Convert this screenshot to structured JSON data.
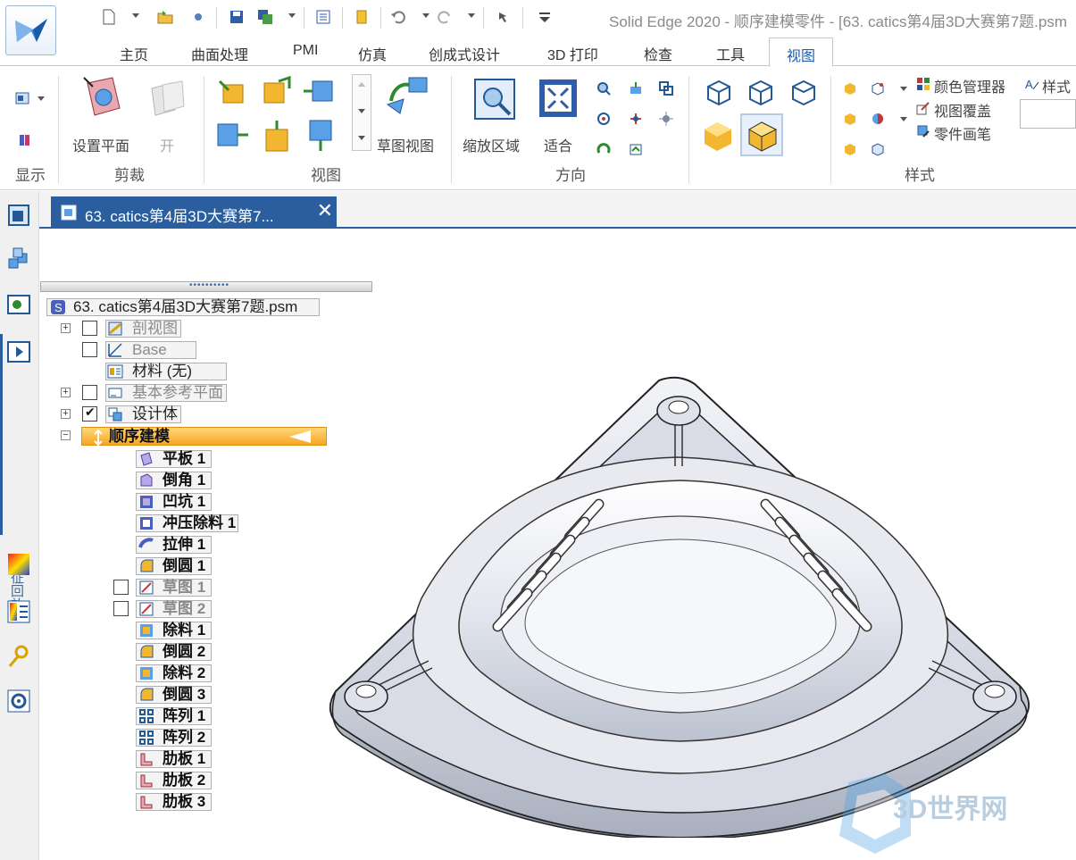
{
  "app": {
    "title": "Solid Edge 2020 - 顺序建模零件 - [63. catics第4届3D大赛第7题.psm"
  },
  "tabs": [
    {
      "label": "主页"
    },
    {
      "label": "曲面处理"
    },
    {
      "label": "PMI"
    },
    {
      "label": "仿真"
    },
    {
      "label": "创成式设计"
    },
    {
      "label": "3D 打印"
    },
    {
      "label": "检查"
    },
    {
      "label": "工具"
    },
    {
      "label": "视图",
      "active": true
    }
  ],
  "ribbon": {
    "groups": {
      "display": "显示",
      "clip": "剪裁",
      "views": "视图",
      "orient": "方向",
      "style": "样式"
    },
    "buttons": {
      "set_plane": "设置平面",
      "open": "开",
      "sketch_view": "草图视图",
      "zoom_area": "缩放区域",
      "fit": "适合",
      "color_manager": "颜色管理器",
      "style": "样式",
      "view_override": "视图覆盖",
      "part_painter": "零件画笔"
    }
  },
  "document_tab": {
    "title": "63. catics第4届3D大赛第7...",
    "close": "✕"
  },
  "left_toolbar": {
    "replay_label": "特征回放"
  },
  "tree": {
    "root": "63. catics第4届3D大赛第7题.psm",
    "nodes": [
      {
        "label": "剖视图",
        "expandable": true,
        "checkbox": "unchecked",
        "dimmed": true
      },
      {
        "label": "Base",
        "expandable": false,
        "checkbox": "unchecked",
        "dimmed": true
      },
      {
        "label": "材料 (无)",
        "expandable": false,
        "checkbox": "none",
        "dimmed": false
      },
      {
        "label": "基本参考平面",
        "expandable": true,
        "checkbox": "unchecked",
        "dimmed": true
      },
      {
        "label": "设计体",
        "expandable": true,
        "checkbox": "checked",
        "dimmed": false
      }
    ],
    "sequence": {
      "label": "顺序建模",
      "expander": "−",
      "features": [
        {
          "label": "平板 1",
          "icon": "tab-feature-icon",
          "dimmed": false
        },
        {
          "label": "倒角 1",
          "icon": "chamfer-feature-icon",
          "dimmed": false
        },
        {
          "label": "凹坑 1",
          "icon": "dimple-feature-icon",
          "dimmed": false
        },
        {
          "label": "冲压除料 1",
          "icon": "drawn-cutout-icon",
          "dimmed": false
        },
        {
          "label": "拉伸 1",
          "icon": "louver-feature-icon",
          "dimmed": false
        },
        {
          "label": "倒圆 1",
          "icon": "round-feature-icon",
          "dimmed": false
        },
        {
          "label": "草图 1",
          "icon": "sketch-feature-icon",
          "dimmed": true,
          "checkbox": true
        },
        {
          "label": "草图 2",
          "icon": "sketch-feature-icon",
          "dimmed": true,
          "checkbox": true
        },
        {
          "label": "除料 1",
          "icon": "cutout-feature-icon",
          "dimmed": false
        },
        {
          "label": "倒圆 2",
          "icon": "round-feature-icon",
          "dimmed": false
        },
        {
          "label": "除料 2",
          "icon": "cutout-feature-icon",
          "dimmed": false
        },
        {
          "label": "倒圆 3",
          "icon": "round-feature-icon",
          "dimmed": false
        },
        {
          "label": "阵列 1",
          "icon": "pattern-feature-icon",
          "dimmed": false
        },
        {
          "label": "阵列 2",
          "icon": "pattern-feature-icon",
          "dimmed": false
        },
        {
          "label": "肋板 1",
          "icon": "rib-feature-icon",
          "dimmed": false
        },
        {
          "label": "肋板 2",
          "icon": "rib-feature-icon",
          "dimmed": false
        },
        {
          "label": "肋板 3",
          "icon": "rib-feature-icon",
          "dimmed": false
        }
      ]
    }
  },
  "colors": {
    "accent": "#2a5e9e",
    "selection": "#f6a623",
    "part_body": "#c9cdd8"
  }
}
